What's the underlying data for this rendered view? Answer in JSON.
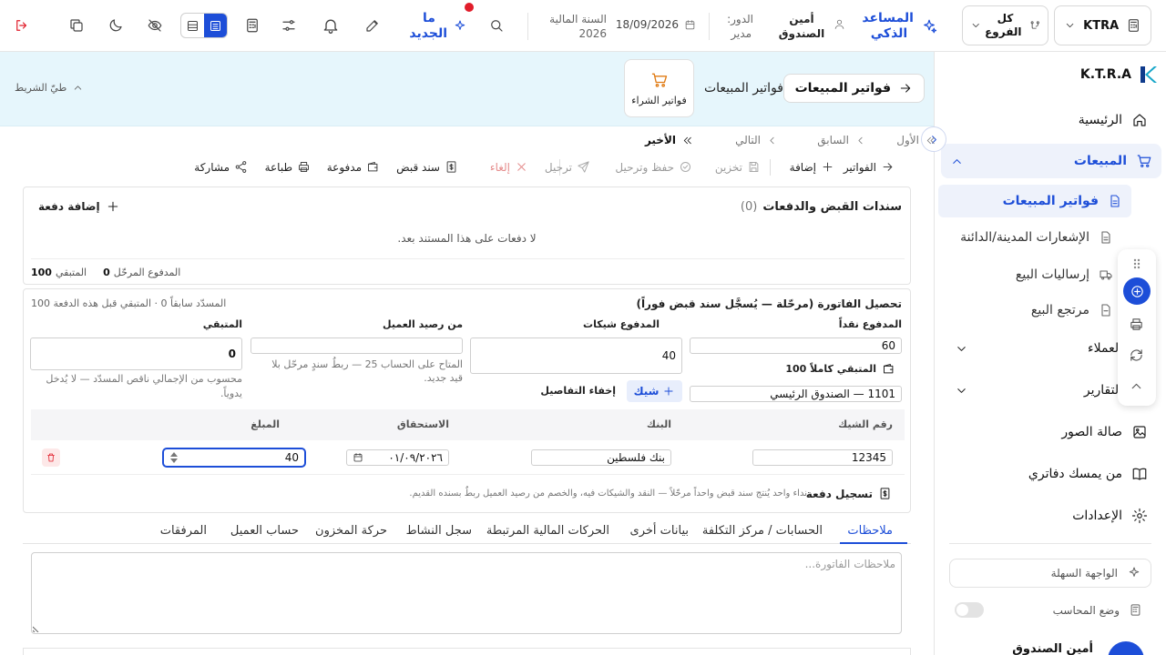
{
  "topbar": {
    "company": "KTRA",
    "branch": "كل الفروع",
    "assistant": "المساعد الذكي",
    "user_name": "أمين الصندوق",
    "role_label": "الدور:",
    "role_value": "مدير",
    "date": "18/09/2026",
    "fiscal_label": "السنة المالية",
    "fiscal_year": "2026",
    "whats_new": "ما الجديد",
    "accent": "#1d4ed8",
    "alert_dot": "#e11d2a"
  },
  "sidebar": {
    "logo": "K.T.R.A",
    "home": "الرئيسية",
    "sales": "المبيعات",
    "sales_items": [
      "فواتير المبيعات",
      "الإشعارات المدينة/الدائنة",
      "إرساليات البيع",
      "مرتجع البيع"
    ],
    "customers": "العملاء",
    "reports": "التقارير",
    "gallery": "صالة الصور",
    "bookkeeper": "من يمسك دفاتري",
    "settings": "الإعدادات",
    "easy_ui": "الواجهة السهلة",
    "accountant_mode": "وضع المحاسب",
    "user_footer": "أمين الصندوق"
  },
  "band": {
    "back_title": "فواتير المبيعات",
    "current": "فواتير المبيعات",
    "purchase": "فواتير الشراء",
    "collapse": "طيّ الشريط"
  },
  "pager": {
    "first": "الأول",
    "prev": "السابق",
    "next": "التالي",
    "last": "الأخير"
  },
  "toolbar": {
    "invoices": "الفواتير",
    "add": "إضافة",
    "store": "تخزين",
    "save_post": "حفظ وترحيل",
    "post": "ترحيل",
    "cancel": "إلغاء",
    "receipt": "سند قبض",
    "paid": "مدفوعة",
    "print": "طباعة",
    "share": "مشاركة"
  },
  "payments": {
    "title": "سندات القبض والدفعات",
    "count": "(0)",
    "add_payment": "إضافة دفعة",
    "empty": "لا دفعات على هذا المستند بعد.",
    "posted_paid_label": "المدفوع المرحّل",
    "posted_paid_value": "0",
    "remaining_label": "المتبقي",
    "remaining_value": "100"
  },
  "collect": {
    "title": "تحصيل الفاتورة (مرحّلة — يُسجَّل سند قبض فوراً)",
    "hint": "المسدّد سابقاً 0 · المتبقي قبل هذه الدفعة 100",
    "cash_label": "المدفوع نقداً",
    "cash_value": "60",
    "remaining_full": "المتبقي كاملاً 100",
    "cashbox": "1101 — الصندوق الرئيسي",
    "cheques_label": "المدفوع شيكات",
    "cheques_value": "40",
    "add_cheque": "شيك",
    "hide_details": "إخفاء التفاصيل",
    "balance_label": "من رصيد العميل",
    "balance_note": "المتاح على الحساب 25 — ربطُ سندٍ مرحّل بلا قيد جديد.",
    "remain_label": "المتبقي",
    "remain_value": "0",
    "remain_note": "محسوب من الإجمالي ناقص المسدّد — لا يُدخل يدوياً.",
    "cheque_headers": [
      "رقم الشيك",
      "البنك",
      "الاستحقاق",
      "المبلغ"
    ],
    "cheque_row": {
      "number": "12345",
      "bank": "بنك فلسطين",
      "due": "٠١/٠٩/٢٠٢٦",
      "amount": "40"
    },
    "record_payment": "تسجيل دفعة",
    "record_note": "نداء واحد يُنتج سند قبض واحداً مرحّلاً — النقد والشيكات فيه، والخصم من رصيد العميل ربطٌ بسنده القديم."
  },
  "tabs": [
    "ملاحظات",
    "الحسابات / مركز التكلفة",
    "بيانات أخرى",
    "الحركات المالية المرتبطة",
    "سجل النشاط",
    "حركة المخزون",
    "حساب العميل",
    "المرفقات"
  ],
  "notes_placeholder": "ملاحظات الفاتورة..."
}
